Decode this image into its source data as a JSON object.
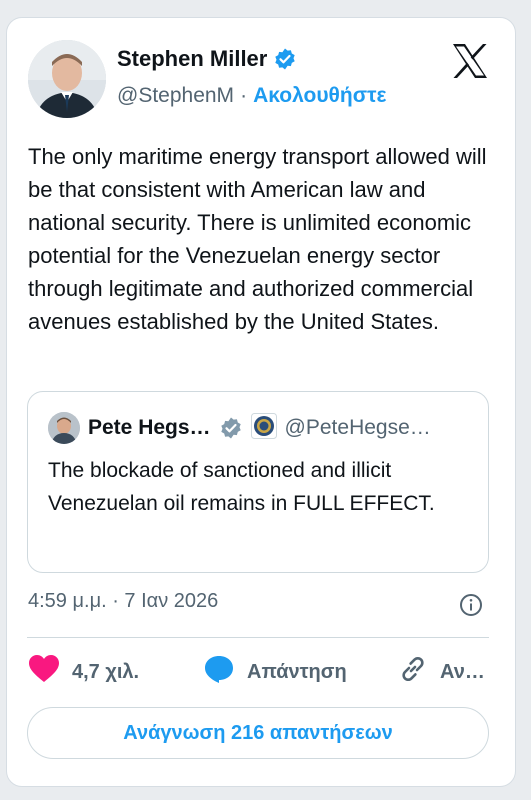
{
  "author": {
    "name": "Stephen Miller",
    "handle": "@StephenM",
    "separator": "·",
    "follow_label": "Ακολουθήστε"
  },
  "tweet": {
    "text": "The only maritime energy transport allowed will be that consistent with American law and national security. There is unlimited economic potential for the Venezuelan energy sector through legitimate and authorized commercial avenues established by the United States."
  },
  "quote": {
    "name": "Pete Hegs…",
    "handle": "@PeteHegse…",
    "text": "The blockade of sanctioned and illicit Venezuelan oil remains in FULL EFFECT."
  },
  "meta": {
    "timestamp": "4:59 μ.μ. · 7 Ιαν 2026"
  },
  "actions": {
    "likes": "4,7 χιλ.",
    "reply_label": "Απάντηση",
    "copy_label": "Αν…"
  },
  "read_replies_label": "Ανάγνωση 216 απαντήσεων",
  "colors": {
    "accent": "#1d9bf0",
    "like": "#f91880",
    "text": "#0f1419",
    "muted": "#536471"
  },
  "icons": [
    "x-logo-icon",
    "verified-badge-icon",
    "gray-verified-badge-icon",
    "government-seal-icon",
    "info-icon",
    "heart-icon",
    "reply-icon",
    "link-icon"
  ]
}
